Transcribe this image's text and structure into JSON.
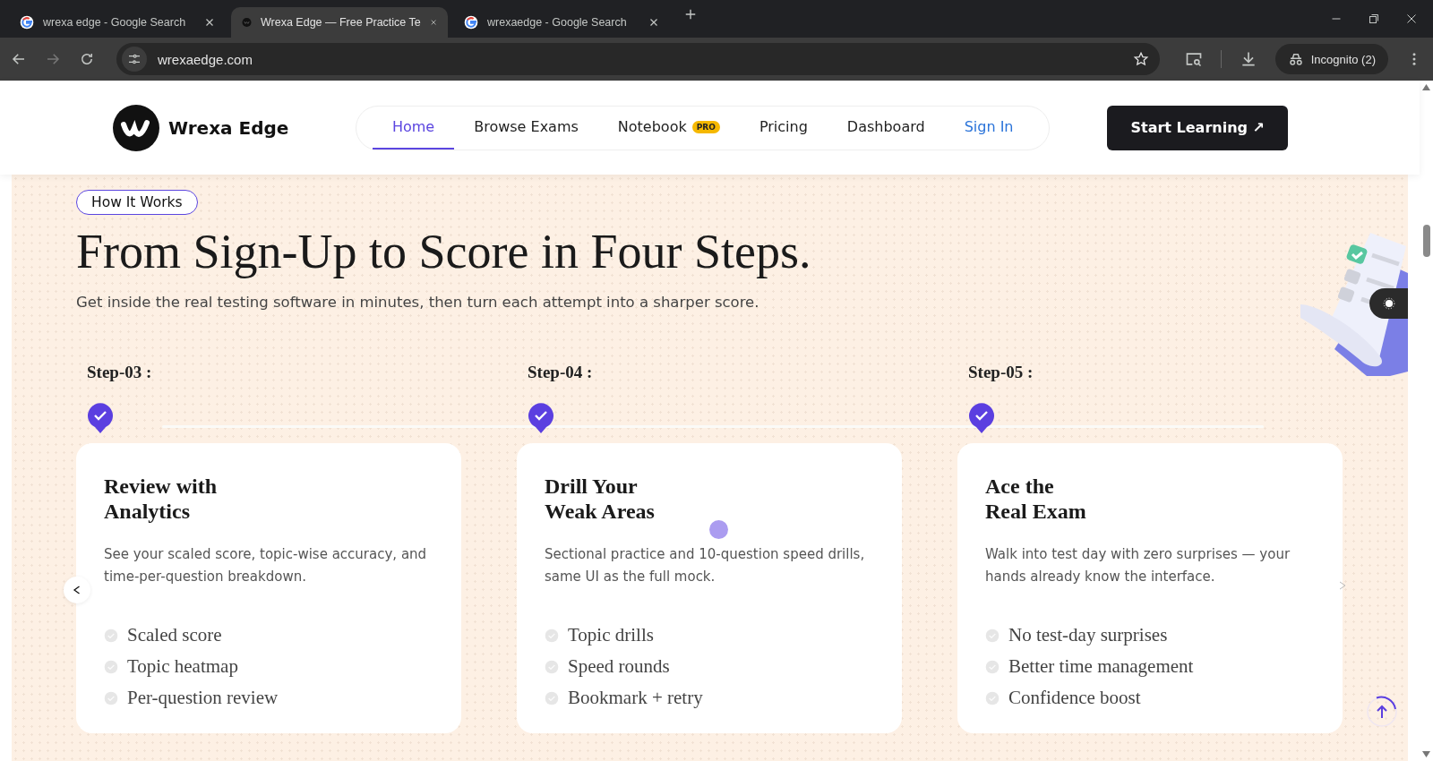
{
  "browser": {
    "tabs": [
      {
        "title": "wrexa edge - Google Search",
        "kind": "google",
        "selected": false
      },
      {
        "title": "Wrexa Edge — Free Practice Te",
        "kind": "site",
        "selected": true
      },
      {
        "title": "wrexaedge - Google Search",
        "kind": "google",
        "selected": false
      }
    ],
    "address": "wrexaedge.com",
    "profile": "Incognito (2)"
  },
  "header": {
    "brand": "Wrexa Edge",
    "nav": [
      {
        "label": "Home",
        "selected": true,
        "kind": "link"
      },
      {
        "label": "Browse Exams",
        "selected": false,
        "kind": "link"
      },
      {
        "label": "Notebook",
        "selected": false,
        "kind": "link",
        "badge": "PRO"
      },
      {
        "label": "Pricing",
        "selected": false,
        "kind": "link"
      },
      {
        "label": "Dashboard",
        "selected": false,
        "kind": "link"
      },
      {
        "label": "Sign In",
        "selected": false,
        "kind": "signin"
      }
    ],
    "cta": "Start Learning ↗"
  },
  "section": {
    "badge": "How It Works",
    "heading": "From Sign-Up to Score in Four Steps.",
    "subtitle": "Get inside the real testing software in minutes, then turn each attempt into a sharper score.",
    "steps": [
      {
        "label": "Step-03 :",
        "title": "Review with\nAnalytics",
        "description": "See your scaled score, topic-wise accuracy, and time-per-question breakdown.",
        "features": [
          "Scaled score",
          "Topic heatmap",
          "Per-question review"
        ]
      },
      {
        "label": "Step-04 :",
        "title": "Drill Your\nWeak Areas",
        "description": "Sectional practice and 10-question speed drills, same UI as the full mock.",
        "features": [
          "Topic drills",
          "Speed rounds",
          "Bookmark + retry"
        ]
      },
      {
        "label": "Step-05 :",
        "title": "Ace the\nReal Exam",
        "description": "Walk into test day with zero surprises — your hands already know the interface.",
        "features": [
          "No test-day surprises",
          "Better time management",
          "Confidence boost"
        ]
      }
    ]
  }
}
